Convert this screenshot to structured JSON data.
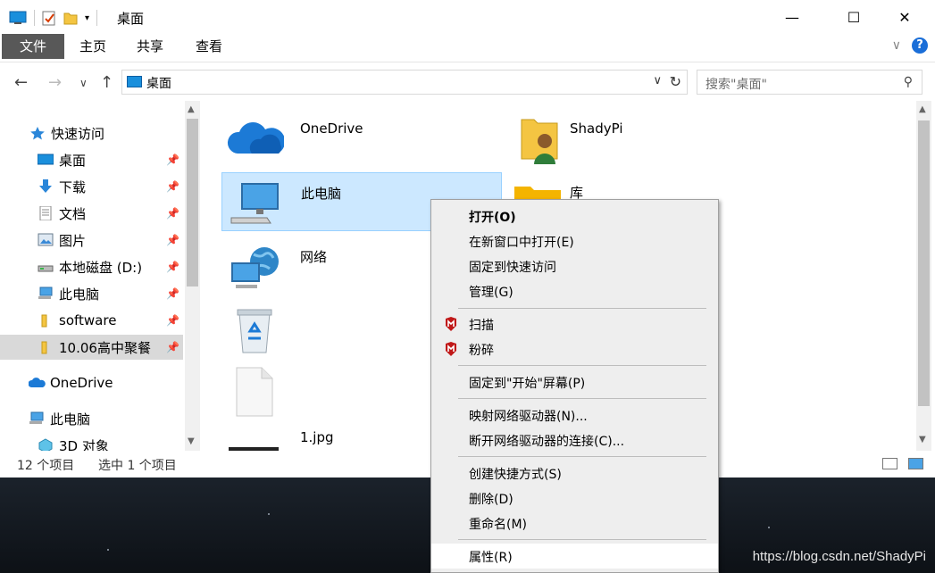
{
  "window": {
    "title": "桌面",
    "minimize_glyph": "—",
    "maximize_glyph": "☐",
    "close_glyph": "✕"
  },
  "ribbon": {
    "tabs": [
      {
        "label": "文件",
        "active": true
      },
      {
        "label": "主页"
      },
      {
        "label": "共享"
      },
      {
        "label": "查看"
      }
    ],
    "help_label": "?"
  },
  "nav": {
    "address": "桌面",
    "search_placeholder": "搜索\"桌面\""
  },
  "sidebar": {
    "quick_access": "快速访问",
    "items": [
      {
        "label": "桌面",
        "icon": "desktop-icon",
        "pinned": true
      },
      {
        "label": "下载",
        "icon": "download-icon",
        "pinned": true
      },
      {
        "label": "文档",
        "icon": "document-icon",
        "pinned": true
      },
      {
        "label": "图片",
        "icon": "picture-icon",
        "pinned": true
      },
      {
        "label": "本地磁盘 (D:)",
        "icon": "drive-icon",
        "pinned": true
      },
      {
        "label": "此电脑",
        "icon": "computer-icon",
        "pinned": true
      },
      {
        "label": "software",
        "icon": "folder-icon",
        "pinned": true
      },
      {
        "label": "10.06高中聚餐",
        "icon": "folder-icon",
        "pinned": true,
        "selected": true
      }
    ],
    "onedrive": "OneDrive",
    "this_pc": "此电脑",
    "objects_3d": "3D 对象"
  },
  "content": {
    "items": [
      {
        "label": "OneDrive",
        "icon": "onedrive-icon"
      },
      {
        "label": "ShadyPi",
        "icon": "user-folder-icon"
      },
      {
        "label": "此电脑",
        "icon": "computer-icon",
        "selected": true
      },
      {
        "label": "库",
        "icon": "library-icon"
      },
      {
        "label": "网络",
        "icon": "network-icon"
      },
      {
        "label": "",
        "icon": "recycle-bin-icon"
      },
      {
        "label": "",
        "icon": "blank-file-icon"
      },
      {
        "label": "1.jpg",
        "icon": "image-file-icon"
      }
    ]
  },
  "status": {
    "count": "12 个项目",
    "selected": "选中 1 个项目"
  },
  "context_menu": {
    "items": [
      {
        "label": "打开(O)",
        "bold": true
      },
      {
        "label": "在新窗口中打开(E)"
      },
      {
        "label": "固定到快速访问"
      },
      {
        "label": "管理(G)"
      },
      {
        "label": "扫描",
        "icon": "mcafee-icon"
      },
      {
        "label": "粉碎",
        "icon": "mcafee-icon"
      },
      {
        "label": "固定到\"开始\"屏幕(P)"
      },
      {
        "label": "映射网络驱动器(N)..."
      },
      {
        "label": "断开网络驱动器的连接(C)..."
      },
      {
        "label": "创建快捷方式(S)"
      },
      {
        "label": "删除(D)"
      },
      {
        "label": "重命名(M)"
      },
      {
        "label": "属性(R)"
      }
    ]
  },
  "watermark": "https://blog.csdn.net/ShadyPi",
  "colors": {
    "accent": "#0078d7",
    "selection_bg": "#cce8ff",
    "file_tab": "#585858",
    "mcafee_red": "#c01818"
  }
}
